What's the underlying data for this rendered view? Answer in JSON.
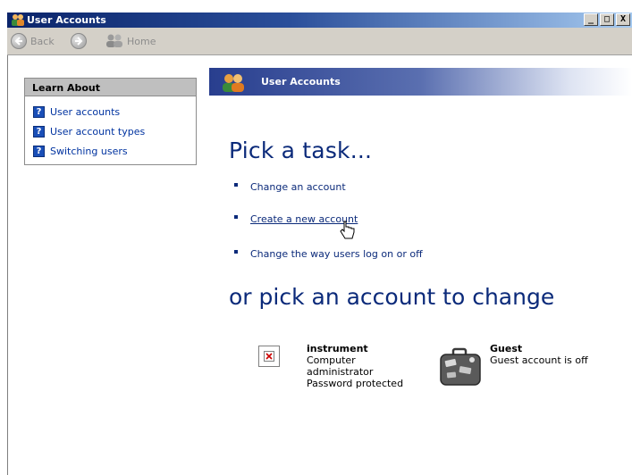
{
  "window": {
    "title": "User Accounts",
    "controls": [
      "_",
      "□",
      "X"
    ]
  },
  "toolbar": {
    "back_label": "Back",
    "forward_label": "",
    "home_label": "Home"
  },
  "learn_about": {
    "header": "Learn About",
    "items": [
      {
        "icon": "help-icon",
        "label": "User accounts"
      },
      {
        "icon": "help-icon",
        "label": "User account types"
      },
      {
        "icon": "help-icon",
        "label": "Switching users"
      }
    ]
  },
  "main": {
    "header_title": "User Accounts",
    "pick_task_heading": "Pick a task...",
    "tasks": [
      {
        "label": "Change an account"
      },
      {
        "label": "Create a new account"
      },
      {
        "label": "Change the way users log on or off"
      }
    ],
    "pick_account_heading": "or pick an account to change",
    "accounts": [
      {
        "name": "instrument",
        "icon": "broken-image-icon",
        "lines": [
          "Computer",
          "administrator",
          "Password protected"
        ]
      },
      {
        "name": "Guest",
        "icon": "suitcase-icon",
        "lines": [
          "Guest account is off"
        ]
      }
    ]
  },
  "colors": {
    "title_bar_start": "#0a246a",
    "heading_blue": "#0b2a7a",
    "link_blue": "#0033a0",
    "toolbar_gray": "#d4d0c8"
  }
}
